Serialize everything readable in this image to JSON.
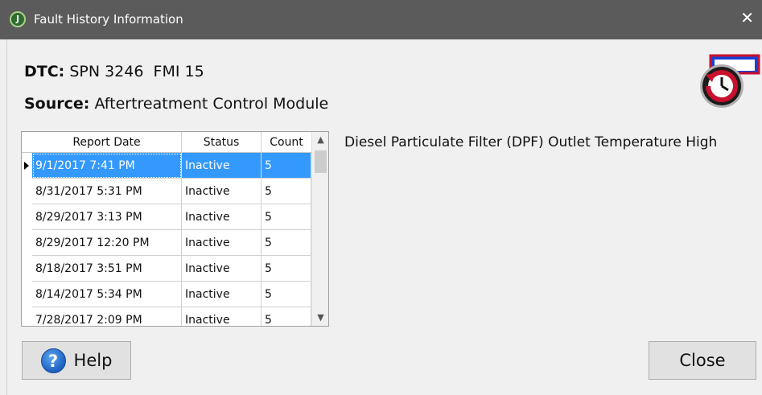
{
  "window": {
    "title": "Fault History Information",
    "close_glyph": "✕"
  },
  "fault": {
    "dtc_label": "DTC:",
    "dtc_value": "SPN 3246  FMI 15",
    "source_label": "Source:",
    "source_value": "Aftertreatment Control Module",
    "description": "Diesel Particulate Filter (DPF) Outlet Temperature High"
  },
  "history_grid": {
    "columns": [
      "Report Date",
      "Status",
      "Count"
    ],
    "rows": [
      {
        "date": "9/1/2017 7:41 PM",
        "status": "Inactive",
        "count": "5",
        "selected": true
      },
      {
        "date": "8/31/2017 5:31 PM",
        "status": "Inactive",
        "count": "5",
        "selected": false
      },
      {
        "date": "8/29/2017 3:13 PM",
        "status": "Inactive",
        "count": "5",
        "selected": false
      },
      {
        "date": "8/29/2017 12:20 PM",
        "status": "Inactive",
        "count": "5",
        "selected": false
      },
      {
        "date": "8/18/2017 3:51 PM",
        "status": "Inactive",
        "count": "5",
        "selected": false
      },
      {
        "date": "8/14/2017 5:34 PM",
        "status": "Inactive",
        "count": "5",
        "selected": false
      },
      {
        "date": "7/28/2017 2:09 PM",
        "status": "Inactive",
        "count": "5",
        "selected": false
      }
    ],
    "scroll_up_glyph": "▲",
    "scroll_down_glyph": "▼"
  },
  "buttons": {
    "help_label": "Help",
    "help_icon_glyph": "?",
    "close_label": "Close"
  },
  "icons": {
    "app_icon": "app-logo-icon",
    "history_icon": "fault-history-clock-icon",
    "help_icon": "help-question-icon"
  },
  "colors": {
    "titlebar": "#5b5b5b",
    "selection": "#3399ff",
    "help_icon": "#1d5fbf",
    "history_icon_ring": "#c8102e"
  }
}
